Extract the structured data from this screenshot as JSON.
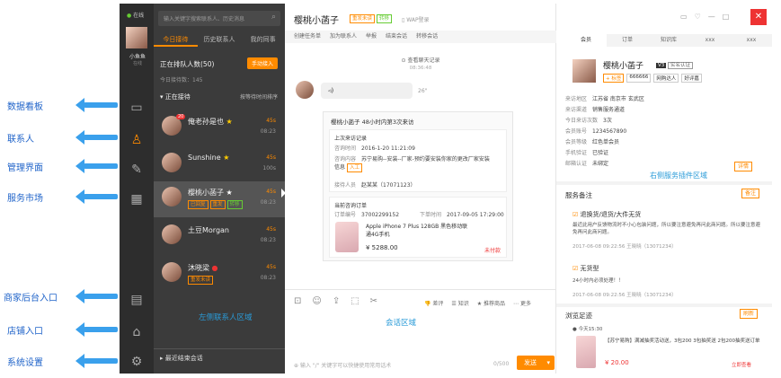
{
  "callouts": {
    "data_board": "数据看板",
    "contacts": "联系人",
    "manage": "管理界面",
    "service_market": "服务市场",
    "merchant_entry": "商家后台入口",
    "store_entry": "店铺入口",
    "system_settings": "系统设置"
  },
  "rail": {
    "status": "在线",
    "user": "小鱼鱼",
    "user_sub": "在线"
  },
  "list": {
    "search_placeholder": "输入关键字搜索联系人、历史消息",
    "tabs": [
      {
        "label": "今日接待"
      },
      {
        "label": "历史联系人"
      },
      {
        "label": "我的同事"
      }
    ],
    "queue_title": "正在排队人数(50)",
    "queue_button": "手动接入",
    "queue_sub": "今日接待数：145",
    "section_active": "正在接待",
    "section_sort": "按等待时间排序",
    "contacts": [
      {
        "name": "俺老孙是也",
        "badge": "20",
        "time": "45s",
        "sub": "08:23",
        "tags": []
      },
      {
        "name": "Sunshine",
        "badge": "",
        "time": "45s",
        "sub": "100s",
        "tags": []
      },
      {
        "name": "樱桃小菡子",
        "badge": "",
        "time": "45s",
        "sub": "08:23",
        "tags": [
          "已回复",
          "重发",
          "转移"
        ]
      },
      {
        "name": "土豆Morgan",
        "badge": "",
        "time": "45s",
        "sub": "08:23",
        "tags": []
      },
      {
        "name": "沐晓梁",
        "badge": "",
        "time": "45s",
        "sub": "08:23",
        "tags": [
          "重发未读"
        ]
      }
    ],
    "region_label": "左侧联系人区域",
    "recent_finished": "最近结束会话"
  },
  "chat": {
    "title": "樱桃小菡子",
    "title_tag1": "重发未读",
    "title_tag2": "转移",
    "wap": "WAP登录",
    "toolbar": [
      "创建任务单",
      "加为联系人",
      "举报",
      "结束会话",
      "转移会话"
    ],
    "history_link": "查看聊天记录",
    "time1": "08:36:48",
    "voice": "26\"",
    "card_title": "樱桃小菡子 48小时内第3次来访",
    "last_visit": "上次来访记录",
    "visit_time_label": "咨询时间",
    "visit_time": "2016-1-20 11:21:09",
    "visit_content_label": "咨询内容",
    "visit_content": "苏宁易购--安装--厂家-预约要安装你家的更改厂家安装信息",
    "visit_btn": "入工",
    "reception_label": "接待人员",
    "reception": "赵某某（17071123）",
    "order_title": "当前咨询订单",
    "order_no_label": "订单编号",
    "order_no": "37002299152",
    "order_time_label": "下单时间",
    "order_time": "2017-09-05 17:29:00",
    "product": "Apple iPhone 7 Plus 128GB 黑色移动联通4G手机",
    "price": "¥ 5288.00",
    "unpaid": "未付款",
    "tools": [
      "差评",
      "知识",
      "推荐商品",
      "更多"
    ],
    "region_label": "会话区域",
    "input_placeholder": "输入 \"/\" 关键字可以快捷使用常用话术",
    "counter": "0/500",
    "send": "发送"
  },
  "right": {
    "tabs": [
      {
        "label": "会员"
      },
      {
        "label": "订单"
      },
      {
        "label": "知识库"
      },
      {
        "label": "xxx"
      },
      {
        "label": "xxx"
      }
    ],
    "name": "樱桃小菡子",
    "level": "V3",
    "verified": "实名认证",
    "tags": [
      "+ 标签",
      "666666",
      "网购达人",
      "好评嘉"
    ],
    "fields": [
      {
        "k": "来访地区",
        "v": "江苏省 南京市 玄武区"
      },
      {
        "k": "来访渠道",
        "v": "销售服务通道"
      },
      {
        "k": "今日来访次数",
        "v": "3次"
      },
      {
        "k": "会员账号",
        "v": "1234567890"
      },
      {
        "k": "会员等级",
        "v": "红色单会员"
      },
      {
        "k": "手机验证",
        "v": "已验证"
      },
      {
        "k": "邮箱认证",
        "v": "未绑定"
      }
    ],
    "region_label": "右侧服务插件区域",
    "more": "详情",
    "notes_title": "服务备注",
    "notes_btn": "备注",
    "notes": [
      {
        "title": "退换货/退货/大件无货",
        "text": "最近此用户反馈物流时不小心包装问题，所以要注意避免再问此商问题。所以要注意避免再问此商问题。",
        "meta": "2017-06-08 09:22:56 王晓晓（13071234）"
      },
      {
        "title": "无货型",
        "text": "24小时内必须处理！！",
        "meta": "2017-06-08 09:22:56 王晓晓（13071234）"
      }
    ],
    "browse_title": "浏览足迹",
    "browse_btn": "刷新",
    "browse_day": "今天15:30",
    "browse_item": "【苏宁易购】满减抽奖活动送，3包200 3包抽奖送 2包200抽奖送订单",
    "browse_price": "¥ 20.00",
    "browse_tag": "立即查看"
  }
}
